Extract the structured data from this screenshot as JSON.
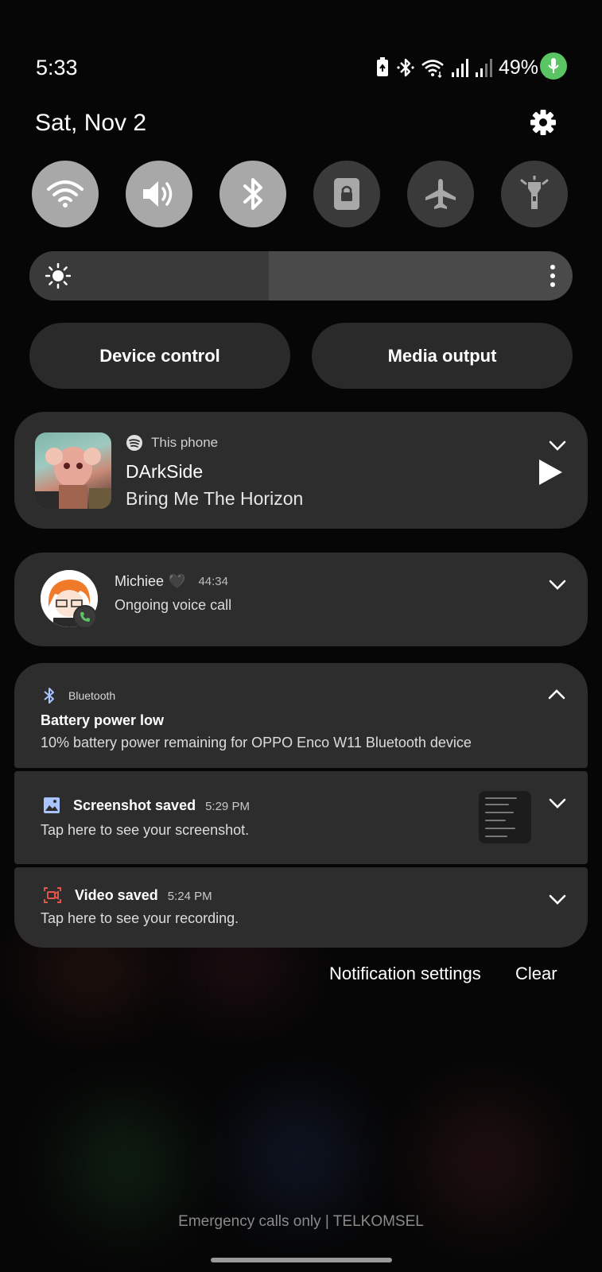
{
  "status_bar": {
    "time": "5:33",
    "battery_percent": "49%",
    "icons": [
      "battery-saver-icon",
      "bluetooth-icon",
      "wifi-icon",
      "signal-icon",
      "signal-icon-2",
      "battery-icon",
      "mic-in-use-icon"
    ],
    "mic_color": "#5bc563"
  },
  "header": {
    "date": "Sat, Nov 2",
    "settings_icon": "gear-icon"
  },
  "quick_toggles": [
    {
      "icon": "wifi-icon",
      "state": "on"
    },
    {
      "icon": "sound-icon",
      "state": "on"
    },
    {
      "icon": "bluetooth-icon",
      "state": "on"
    },
    {
      "icon": "rotation-lock-icon",
      "state": "off"
    },
    {
      "icon": "airplane-icon",
      "state": "off"
    },
    {
      "icon": "flashlight-icon",
      "state": "off"
    }
  ],
  "brightness": {
    "level": 0.44,
    "icon": "sun-icon"
  },
  "buttons": {
    "device_control": "Device control",
    "media_output": "Media output"
  },
  "media": {
    "source": "This phone",
    "title": "DArkSide",
    "artist": "Bring Me The Horizon",
    "app_icon": "spotify-icon"
  },
  "call": {
    "name": "Michiee 🖤",
    "duration": "44:34",
    "status": "Ongoing voice call"
  },
  "notifications": [
    {
      "app": "Bluetooth",
      "title": "Battery power low",
      "text": "10% battery power remaining for OPPO Enco W11 Bluetooth device"
    },
    {
      "title": "Screenshot saved",
      "time": "5:29 PM",
      "text": "Tap here to see your screenshot."
    },
    {
      "title": "Video saved",
      "time": "5:24 PM",
      "text": "Tap here to see your recording."
    }
  ],
  "footer": {
    "notification_settings": "Notification settings",
    "clear": "Clear"
  },
  "carrier": "Emergency calls only | TELKOMSEL"
}
